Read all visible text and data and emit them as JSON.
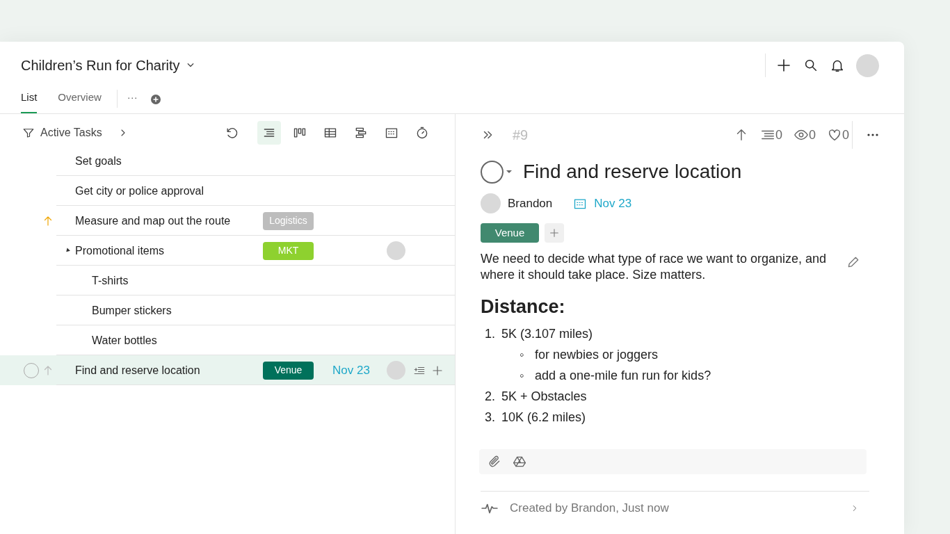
{
  "project": {
    "title": "Children’s Run for Charity"
  },
  "tabs": [
    {
      "label": "List",
      "selected": true
    },
    {
      "label": "Overview",
      "selected": false
    }
  ],
  "more_tabs": "···",
  "filter": {
    "label": "Active Tasks"
  },
  "views": [
    {
      "kind": "list",
      "selected": true
    },
    {
      "kind": "board",
      "selected": false
    },
    {
      "kind": "table",
      "selected": false
    },
    {
      "kind": "gantt",
      "selected": false
    },
    {
      "kind": "calendar",
      "selected": false
    },
    {
      "kind": "timer",
      "selected": false
    }
  ],
  "tasks": [
    {
      "title": "Set goals",
      "selected": false
    },
    {
      "title": "Get city or police approval",
      "selected": false
    },
    {
      "title": "Measure and map out the route",
      "high_priority": true,
      "tag": {
        "text": "Logistics",
        "color": "#bdbdbd"
      },
      "selected": false
    },
    {
      "title": "Promotional items",
      "expanded": true,
      "tag": {
        "text": "MKT",
        "color": "#8ed12f"
      },
      "assignee": true,
      "selected": false,
      "children": [
        {
          "title": "T-shirts",
          "selected": false
        },
        {
          "title": "Bumper stickers",
          "selected": false
        },
        {
          "title": "Water bottles",
          "selected": false
        }
      ]
    },
    {
      "title": "Find and reserve location",
      "completed": false,
      "tag": {
        "text": "Venue",
        "color": "#00715b"
      },
      "date": "Nov 23",
      "assignee": true,
      "selected": true
    }
  ],
  "detail": {
    "completed": false,
    "number": "#9",
    "subtasks": "0",
    "watchers": "0",
    "likes": "0",
    "title": "Find and reserve location",
    "assignee": "Brandon",
    "date": "Nov 23",
    "tags": [
      {
        "text": "Venue",
        "color": "#41896f"
      }
    ],
    "description": "We need to decide what type of race we want to organize, and where it should take place. Size matters.",
    "heading": "Distance:",
    "list": [
      {
        "marker": "1.",
        "text": "5K (3.107 miles)",
        "children": [
          {
            "marker": "◦",
            "text": "for newbies or joggers"
          },
          {
            "marker": "◦",
            "text": "add a one-mile fun run for kids?"
          }
        ]
      },
      {
        "marker": "2.",
        "text": "5K + Obstacles"
      },
      {
        "marker": "3.",
        "text": "10K (6.2 miles)"
      }
    ],
    "activity": "Created by Brandon, Just now"
  }
}
